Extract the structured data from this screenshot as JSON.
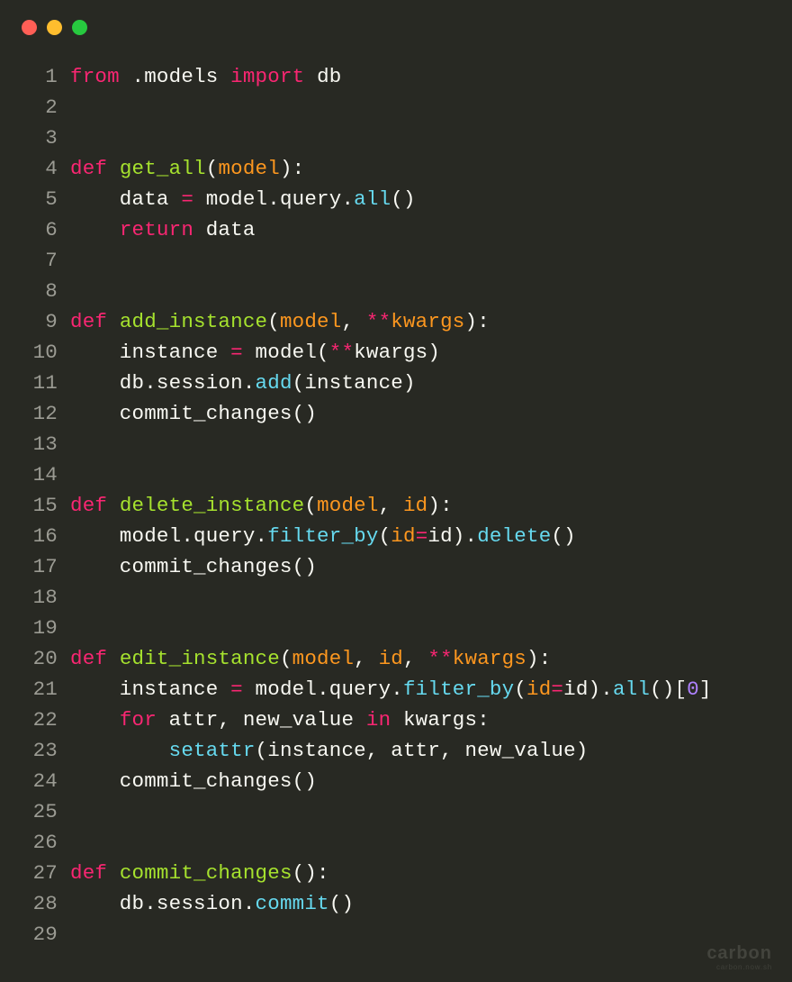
{
  "watermark": {
    "brand": "carbon",
    "sub": "carbon.now.sh"
  },
  "lines": [
    {
      "n": "1",
      "tokens": [
        [
          "from ",
          "kw"
        ],
        [
          ".",
          "name"
        ],
        [
          "models ",
          "name"
        ],
        [
          "import ",
          "kw"
        ],
        [
          "db",
          "name"
        ]
      ]
    },
    {
      "n": "2",
      "tokens": []
    },
    {
      "n": "3",
      "tokens": []
    },
    {
      "n": "4",
      "tokens": [
        [
          "def ",
          "kw"
        ],
        [
          "get_all",
          "def"
        ],
        [
          "(",
          "name"
        ],
        [
          "model",
          "param"
        ],
        [
          "):",
          "name"
        ]
      ]
    },
    {
      "n": "5",
      "tokens": [
        [
          "    data ",
          "name"
        ],
        [
          "=",
          "op"
        ],
        [
          " model",
          "name"
        ],
        [
          ".",
          "name"
        ],
        [
          "query",
          "name"
        ],
        [
          ".",
          "name"
        ],
        [
          "all",
          "call"
        ],
        [
          "()",
          "name"
        ]
      ]
    },
    {
      "n": "6",
      "tokens": [
        [
          "    ",
          "name"
        ],
        [
          "return ",
          "kw"
        ],
        [
          "data",
          "name"
        ]
      ]
    },
    {
      "n": "7",
      "tokens": []
    },
    {
      "n": "8",
      "tokens": []
    },
    {
      "n": "9",
      "tokens": [
        [
          "def ",
          "kw"
        ],
        [
          "add_instance",
          "def"
        ],
        [
          "(",
          "name"
        ],
        [
          "model",
          "param"
        ],
        [
          ", ",
          "name"
        ],
        [
          "**",
          "op"
        ],
        [
          "kwargs",
          "param"
        ],
        [
          "):",
          "name"
        ]
      ]
    },
    {
      "n": "10",
      "tokens": [
        [
          "    instance ",
          "name"
        ],
        [
          "=",
          "op"
        ],
        [
          " model(",
          "name"
        ],
        [
          "**",
          "op"
        ],
        [
          "kwargs)",
          "name"
        ]
      ]
    },
    {
      "n": "11",
      "tokens": [
        [
          "    db",
          "name"
        ],
        [
          ".",
          "name"
        ],
        [
          "session",
          "name"
        ],
        [
          ".",
          "name"
        ],
        [
          "add",
          "call"
        ],
        [
          "(instance)",
          "name"
        ]
      ]
    },
    {
      "n": "12",
      "tokens": [
        [
          "    commit_changes()",
          "name"
        ]
      ]
    },
    {
      "n": "13",
      "tokens": []
    },
    {
      "n": "14",
      "tokens": []
    },
    {
      "n": "15",
      "tokens": [
        [
          "def ",
          "kw"
        ],
        [
          "delete_instance",
          "def"
        ],
        [
          "(",
          "name"
        ],
        [
          "model",
          "param"
        ],
        [
          ", ",
          "name"
        ],
        [
          "id",
          "param"
        ],
        [
          "):",
          "name"
        ]
      ]
    },
    {
      "n": "16",
      "tokens": [
        [
          "    model",
          "name"
        ],
        [
          ".",
          "name"
        ],
        [
          "query",
          "name"
        ],
        [
          ".",
          "name"
        ],
        [
          "filter_by",
          "call"
        ],
        [
          "(",
          "name"
        ],
        [
          "id",
          "param"
        ],
        [
          "=",
          "op"
        ],
        [
          "id",
          "name"
        ],
        [
          ")",
          "name"
        ],
        [
          ".",
          "name"
        ],
        [
          "delete",
          "call"
        ],
        [
          "()",
          "name"
        ]
      ]
    },
    {
      "n": "17",
      "tokens": [
        [
          "    commit_changes()",
          "name"
        ]
      ]
    },
    {
      "n": "18",
      "tokens": []
    },
    {
      "n": "19",
      "tokens": []
    },
    {
      "n": "20",
      "tokens": [
        [
          "def ",
          "kw"
        ],
        [
          "edit_instance",
          "def"
        ],
        [
          "(",
          "name"
        ],
        [
          "model",
          "param"
        ],
        [
          ", ",
          "name"
        ],
        [
          "id",
          "param"
        ],
        [
          ", ",
          "name"
        ],
        [
          "**",
          "op"
        ],
        [
          "kwargs",
          "param"
        ],
        [
          "):",
          "name"
        ]
      ]
    },
    {
      "n": "21",
      "tokens": [
        [
          "    instance ",
          "name"
        ],
        [
          "=",
          "op"
        ],
        [
          " model",
          "name"
        ],
        [
          ".",
          "name"
        ],
        [
          "query",
          "name"
        ],
        [
          ".",
          "name"
        ],
        [
          "filter_by",
          "call"
        ],
        [
          "(",
          "name"
        ],
        [
          "id",
          "param"
        ],
        [
          "=",
          "op"
        ],
        [
          "id",
          "name"
        ],
        [
          ")",
          "name"
        ],
        [
          ".",
          "name"
        ],
        [
          "all",
          "call"
        ],
        [
          "()[",
          "name"
        ],
        [
          "0",
          "num"
        ],
        [
          "]",
          "name"
        ]
      ]
    },
    {
      "n": "22",
      "tokens": [
        [
          "    ",
          "name"
        ],
        [
          "for ",
          "kw"
        ],
        [
          "attr, new_value ",
          "name"
        ],
        [
          "in ",
          "kw"
        ],
        [
          "kwargs:",
          "name"
        ]
      ]
    },
    {
      "n": "23",
      "tokens": [
        [
          "        ",
          "name"
        ],
        [
          "setattr",
          "builtin"
        ],
        [
          "(instance, attr, new_value)",
          "name"
        ]
      ]
    },
    {
      "n": "24",
      "tokens": [
        [
          "    commit_changes()",
          "name"
        ]
      ]
    },
    {
      "n": "25",
      "tokens": []
    },
    {
      "n": "26",
      "tokens": []
    },
    {
      "n": "27",
      "tokens": [
        [
          "def ",
          "kw"
        ],
        [
          "commit_changes",
          "def"
        ],
        [
          "():",
          "name"
        ]
      ]
    },
    {
      "n": "28",
      "tokens": [
        [
          "    db",
          "name"
        ],
        [
          ".",
          "name"
        ],
        [
          "session",
          "name"
        ],
        [
          ".",
          "name"
        ],
        [
          "commit",
          "call"
        ],
        [
          "()",
          "name"
        ]
      ]
    },
    {
      "n": "29",
      "tokens": []
    }
  ],
  "chart_data": null
}
